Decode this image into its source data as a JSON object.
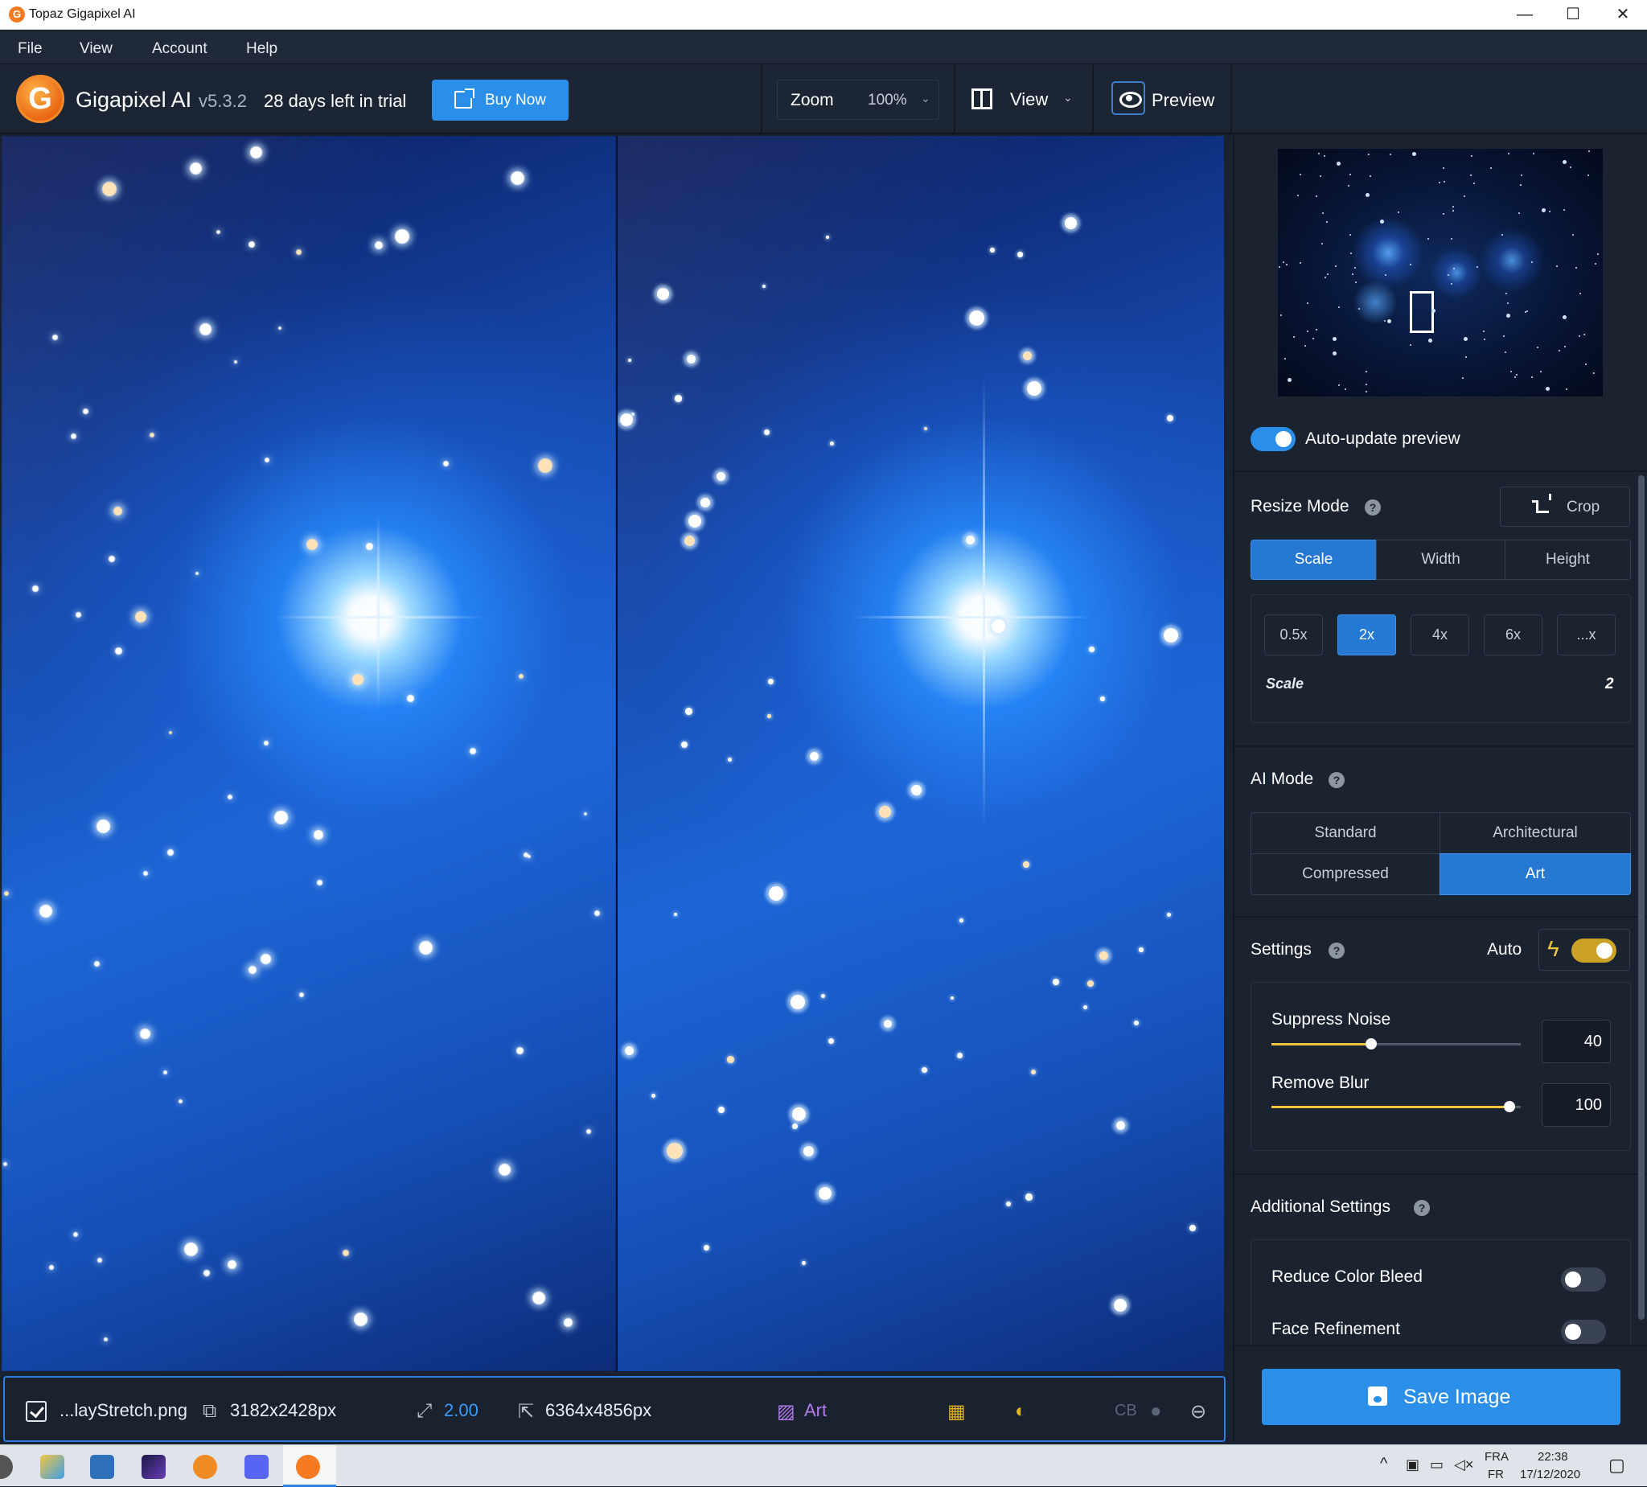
{
  "window": {
    "title": "Topaz Gigapixel AI",
    "controls": [
      "—",
      "☐",
      "✕"
    ]
  },
  "menu": [
    "File",
    "View",
    "Account",
    "Help"
  ],
  "toolbar": {
    "app_name": "Gigapixel AI",
    "version": "v5.3.2",
    "trial": "28 days left in trial",
    "buy_now": "Buy Now",
    "zoom_label": "Zoom",
    "zoom_value": "100%",
    "view_label": "View",
    "preview_label": "Preview"
  },
  "statusbar": {
    "filename": "...layStretch.png",
    "input_size": "3182x2428px",
    "scale": "2.00",
    "output_size": "6364x4856px",
    "ai_mode": "Art",
    "cb": "CB"
  },
  "panel": {
    "auto_update": "Auto-update preview",
    "resize_mode": {
      "title": "Resize Mode",
      "crop": "Crop",
      "tabs": [
        "Scale",
        "Width",
        "Height"
      ],
      "active_tab": "Scale",
      "scale_chips": [
        "0.5x",
        "2x",
        "4x",
        "6x",
        "...x"
      ],
      "active_chip": "2x",
      "scale_label": "Scale",
      "scale_value": "2"
    },
    "ai_mode": {
      "title": "AI Mode",
      "options": [
        "Standard",
        "Architectural",
        "Compressed",
        "Art"
      ],
      "active": "Art"
    },
    "settings": {
      "title": "Settings",
      "auto_label": "Auto",
      "auto_on": true,
      "suppress_noise": {
        "label": "Suppress Noise",
        "value": "40",
        "fraction": 0.4
      },
      "remove_blur": {
        "label": "Remove Blur",
        "value": "100",
        "fraction": 1.0
      }
    },
    "additional": {
      "title": "Additional Settings",
      "reduce_color_bleed": "Reduce Color Bleed",
      "face_refinement": "Face Refinement"
    },
    "save_image": "Save Image"
  },
  "taskbar": {
    "lang": "FRA",
    "lang2": "FR",
    "time": "22:38",
    "date": "17/12/2020"
  },
  "colors": {
    "accent": "#2b8fea",
    "panel_bg": "#1b2331",
    "slider_fill": "#f0c43a",
    "brand_orange": "#f47b20"
  }
}
